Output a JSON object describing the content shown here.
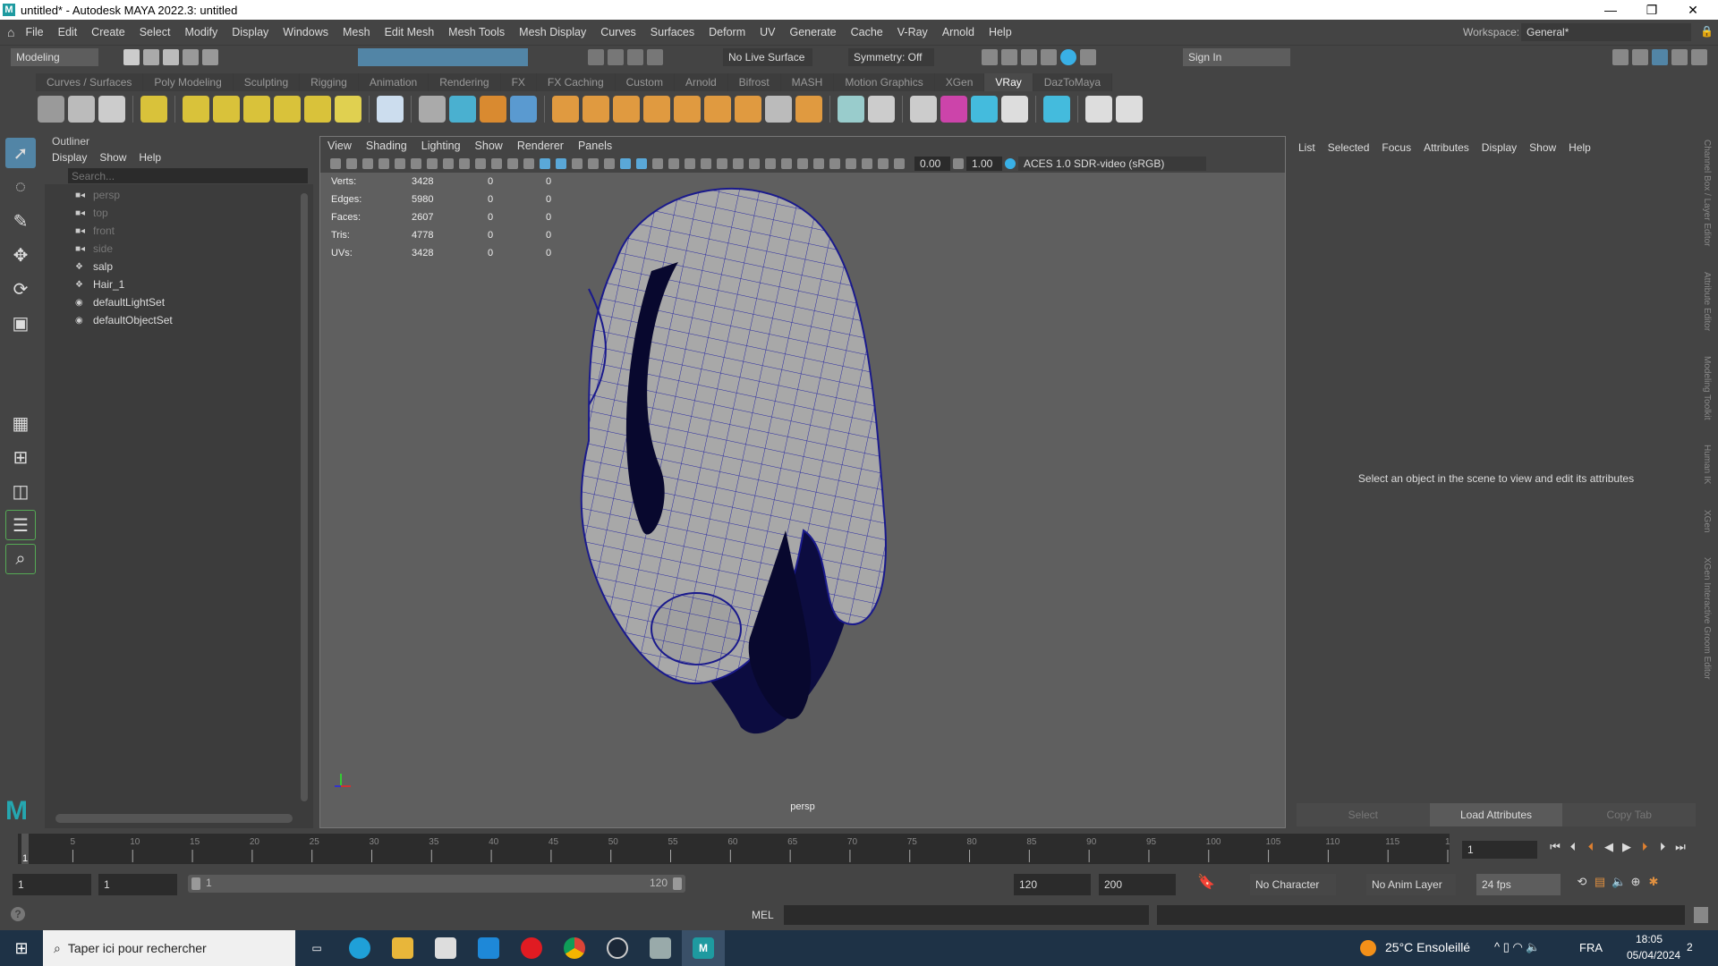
{
  "window": {
    "title": "untitled* - Autodesk MAYA 2022.3: untitled",
    "logo": "M",
    "minimize": "—",
    "restore": "❐",
    "close": "✕"
  },
  "menu": [
    "File",
    "Edit",
    "Create",
    "Select",
    "Modify",
    "Display",
    "Windows",
    "Mesh",
    "Edit Mesh",
    "Mesh Tools",
    "Mesh Display",
    "Curves",
    "Surfaces",
    "Deform",
    "UV",
    "Generate",
    "Cache",
    "V-Ray",
    "Arnold",
    "Help"
  ],
  "workspace": {
    "label": "Workspace:",
    "value": "General*"
  },
  "status": {
    "menuset": "Modeling",
    "live_surface": "No Live Surface",
    "symmetry": "Symmetry: Off",
    "sign_in": "Sign In"
  },
  "shelf_tabs": [
    "Curves / Surfaces",
    "Poly Modeling",
    "Sculpting",
    "Rigging",
    "Animation",
    "Rendering",
    "FX",
    "FX Caching",
    "Custom",
    "Arnold",
    "Bifrost",
    "MASH",
    "Motion Graphics",
    "XGen",
    "VRay",
    "DazToMaya"
  ],
  "shelf_active": "VRay",
  "outliner": {
    "title": "Outliner",
    "menu": [
      "Display",
      "Show",
      "Help"
    ],
    "search_placeholder": "Search...",
    "items": [
      {
        "label": "persp",
        "type": "camera",
        "dim": true
      },
      {
        "label": "top",
        "type": "camera",
        "dim": true
      },
      {
        "label": "front",
        "type": "camera",
        "dim": true
      },
      {
        "label": "side",
        "type": "camera",
        "dim": true
      },
      {
        "label": "salp",
        "type": "transform",
        "dim": false
      },
      {
        "label": "Hair_1",
        "type": "transform",
        "dim": false
      },
      {
        "label": "defaultLightSet",
        "type": "set",
        "dim": false
      },
      {
        "label": "defaultObjectSet",
        "type": "set",
        "dim": false
      }
    ]
  },
  "viewport": {
    "menu": [
      "View",
      "Shading",
      "Lighting",
      "Show",
      "Renderer",
      "Panels"
    ],
    "exposure": "0.00",
    "gamma": "1.00",
    "color_space": "ACES 1.0 SDR-video (sRGB)",
    "camera": "persp",
    "hud": [
      {
        "label": "Verts:",
        "v": [
          "3428",
          "0",
          "0"
        ]
      },
      {
        "label": "Edges:",
        "v": [
          "5980",
          "0",
          "0"
        ]
      },
      {
        "label": "Faces:",
        "v": [
          "2607",
          "0",
          "0"
        ]
      },
      {
        "label": "Tris:",
        "v": [
          "4778",
          "0",
          "0"
        ]
      },
      {
        "label": "UVs:",
        "v": [
          "3428",
          "0",
          "0"
        ]
      }
    ],
    "wire_color": "#1a1a8c"
  },
  "attr": {
    "menu": [
      "List",
      "Selected",
      "Focus",
      "Attributes",
      "Display",
      "Show",
      "Help"
    ],
    "message": "Select an object in the scene to view and edit its attributes",
    "buttons": [
      "Select",
      "Load Attributes",
      "Copy Tab"
    ]
  },
  "side_tabs": [
    "Channel Box / Layer Editor",
    "Attribute Editor",
    "Modeling Toolkit",
    "Human IK",
    "XGen",
    "XGen Interactive Groom Editor"
  ],
  "timeline": {
    "start": 1,
    "end": 120,
    "step": 5,
    "current": 1,
    "current_field": "1"
  },
  "range": {
    "start": "1",
    "anim_start": "1",
    "slider_start": "1",
    "slider_end": "120",
    "end": "120",
    "anim_end": "200",
    "character_set": "No Character Set",
    "anim_layer": "No Anim Layer",
    "fps": "24 fps"
  },
  "cmd": {
    "lang": "MEL",
    "help": "?"
  },
  "taskbar": {
    "search": "Taper ici pour rechercher",
    "weather": "25°C  Ensoleillé",
    "lang": "FRA",
    "time": "18:05",
    "date": "05/04/2024",
    "notif": "2"
  }
}
